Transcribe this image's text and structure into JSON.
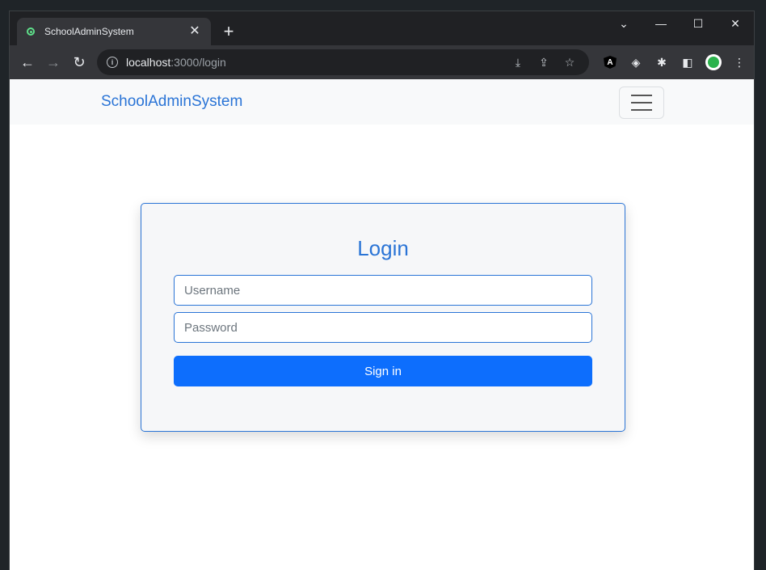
{
  "browser": {
    "tab": {
      "title": "SchoolAdminSystem",
      "close_glyph": "✕"
    },
    "new_tab_glyph": "+",
    "window_controls": {
      "dropdown": "⌄",
      "minimize": "—",
      "maximize": "☐",
      "close": "✕"
    },
    "nav": {
      "back": "←",
      "forward": "→",
      "reload": "↻"
    },
    "address": {
      "host": "localhost",
      "path": ":3000/login",
      "info_glyph": "i"
    },
    "omni_actions": {
      "install": "⤓",
      "share": "⇪",
      "bookmark": "☆"
    },
    "extensions": {
      "angular": "A",
      "layers": "◈",
      "puzzle": "✱",
      "sidepanel": "◧",
      "menu": "⋮"
    }
  },
  "page": {
    "navbar": {
      "brand": "SchoolAdminSystem"
    },
    "login": {
      "title": "Login",
      "username_placeholder": "Username",
      "password_placeholder": "Password",
      "submit_label": "Sign in"
    }
  },
  "colors": {
    "accent": "#2a74d6",
    "button": "#0d6efd",
    "navbar_bg": "#f8f9fa",
    "card_bg": "#f6f7f9"
  }
}
